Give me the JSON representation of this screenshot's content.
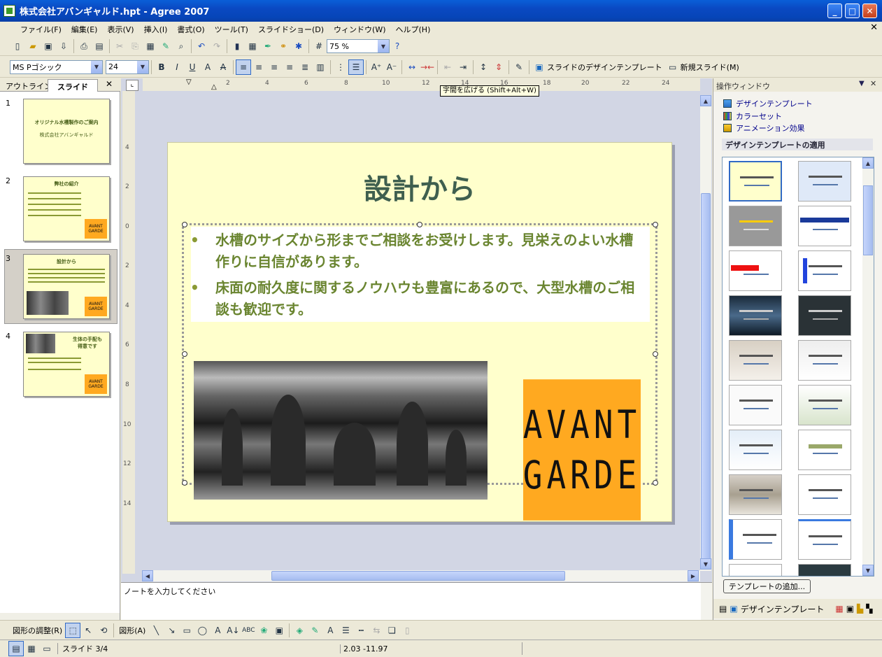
{
  "window": {
    "title": "株式会社アバンギャルド.hpt - Agree 2007"
  },
  "menu": [
    "ファイル(F)",
    "編集(E)",
    "表示(V)",
    "挿入(I)",
    "書式(O)",
    "ツール(T)",
    "スライドショー(D)",
    "ウィンドウ(W)",
    "ヘルプ(H)"
  ],
  "toolbar": {
    "zoom": "75 %",
    "font": "MS Pゴシック",
    "font_size": "24",
    "design_template_label": "スライドのデザインテンプレート",
    "new_slide_label": "新規スライド(M)",
    "tooltip": "字間を広げる (Shift+Alt+W)"
  },
  "leftpane": {
    "tab_outline": "アウトライン",
    "tab_slides": "スライド",
    "close": "✕",
    "slides": [
      {
        "num": "1",
        "title": "オリジナル水槽製作のご案内",
        "sub": "株式会社アバンギャルド"
      },
      {
        "num": "2",
        "title": "弊社の紹介"
      },
      {
        "num": "3",
        "title": "設計から"
      },
      {
        "num": "4",
        "title": "生体の手配も",
        "title2": "得意です"
      }
    ]
  },
  "ruler": {
    "h": [
      "2",
      "4",
      "6",
      "8",
      "10",
      "12",
      "14",
      "16",
      "18",
      "20",
      "22",
      "24"
    ],
    "v": [
      "4",
      "2",
      "0",
      "2",
      "4",
      "6",
      "8",
      "10",
      "12",
      "14"
    ]
  },
  "slide": {
    "title": "設計から",
    "bullets": [
      "水槽のサイズから形までご相談をお受けします。見栄えのよい水槽作りに自信があります。",
      "床面の耐久度に関するノウハウも豊富にあるので、大型水槽のご相談も歓迎です。"
    ],
    "logo_line1": "AVANT",
    "logo_line2": "GARDE"
  },
  "notes": {
    "placeholder": "ノートを入力してください"
  },
  "taskpane": {
    "title": "操作ウィンドウ",
    "links": [
      "デザインテンプレート",
      "カラーセット",
      "アニメーション効果"
    ],
    "section": "デザインテンプレートの適用",
    "add_button": "テンプレートの追加...",
    "footer_label": "デザインテンプレート"
  },
  "drawbar": {
    "adjust": "図形の調整(R)",
    "shapes": "図形(A)"
  },
  "status": {
    "slide": "スライド 3/4",
    "coords": "2.03 -11.97"
  },
  "colors": {
    "slide_bg": "#ffffcc",
    "title": "#3f5f4f",
    "bullet": "#6a8530",
    "logo_bg": "#ffa920",
    "titlebar": "#0a49c2"
  }
}
